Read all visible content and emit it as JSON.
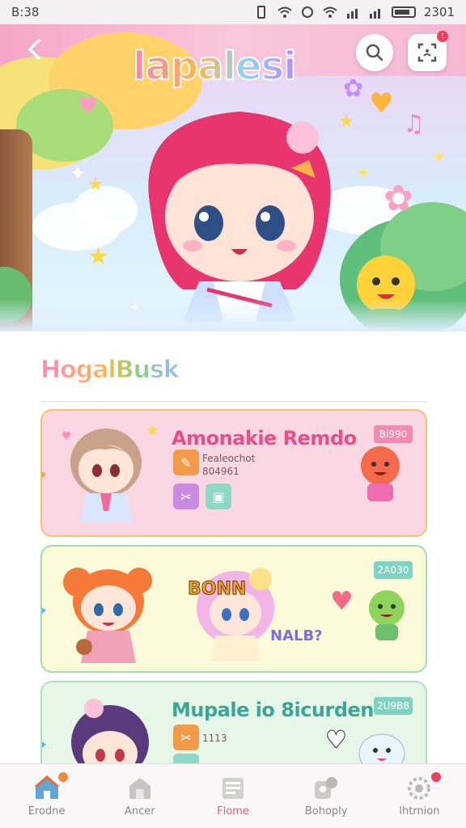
{
  "status_bar": {
    "time": "B:38",
    "battery_text": "2301"
  },
  "header": {
    "title": "lapalesi",
    "notification_badge": "!"
  },
  "section": {
    "title": "HogalBusk"
  },
  "cards": [
    {
      "title": "Amonakie Remdo",
      "sub1": "Fealeochot",
      "sub2": "804961",
      "badge": "Bi990",
      "title_color": "#e94f86",
      "bg": "#fbd6e3",
      "border": "#f7c06e",
      "badge_color": "#f38ab0"
    },
    {
      "sticker1": "BONN",
      "sticker2": "NALB?",
      "badge": "2A030",
      "bg": "#fbfbd9",
      "border": "#9fdcae",
      "badge_color": "#7fd3c3"
    },
    {
      "title": "Mupale io 8icurden",
      "sub1": "1113",
      "badge": "2U9B8",
      "title_color": "#3aa69a",
      "bg": "#e6f7e8",
      "border": "#aee0c4",
      "badge_color": "#7fd3c3"
    }
  ],
  "bottom_nav": {
    "items": [
      {
        "label": "Erodne",
        "active": false
      },
      {
        "label": "Ancer",
        "active": false
      },
      {
        "label": "Flome",
        "active": true
      },
      {
        "label": "Bohoply",
        "active": false
      },
      {
        "label": "lhtrnion",
        "active": false
      }
    ]
  },
  "colors": {
    "accent_pink": "#ef5b7a",
    "hero_pink": "#f6a6c8",
    "nav_home_orange": "#f08a3a"
  },
  "icons": [
    "back-arrow-icon",
    "search-icon",
    "scan-icon",
    "home-icon",
    "store-icon",
    "news-icon",
    "friends-icon",
    "settings-icon"
  ]
}
